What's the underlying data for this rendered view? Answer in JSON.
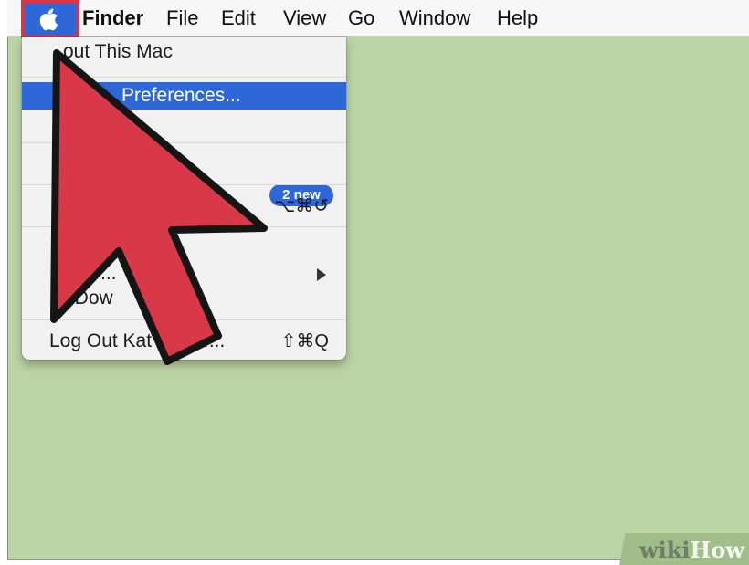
{
  "menubar": {
    "apple_icon": "apple-icon",
    "items": [
      "Finder",
      "File",
      "Edit",
      "View",
      "Go",
      "Window",
      "Help"
    ]
  },
  "apple_menu": {
    "items": [
      {
        "label": "out This Mac"
      },
      {
        "label": "Preferences...",
        "selected": true
      },
      {
        "badge": "2 new"
      },
      {
        "arrow": "submenu-arrow"
      },
      {
        "shortcut": "⌥⌘↺"
      },
      {
        "label": "..."
      },
      {
        "label": "t Dow"
      },
      {
        "label": "Log Out Kat",
        "suffix": "r...",
        "shortcut": "⇧⌘Q"
      }
    ]
  },
  "watermark": {
    "wiki": "wiki",
    "how": "How"
  },
  "colors": {
    "desktop": "#bbd4a5",
    "selection": "#2d67d8",
    "arrow": "#d93849",
    "highlight": "#d43848"
  }
}
